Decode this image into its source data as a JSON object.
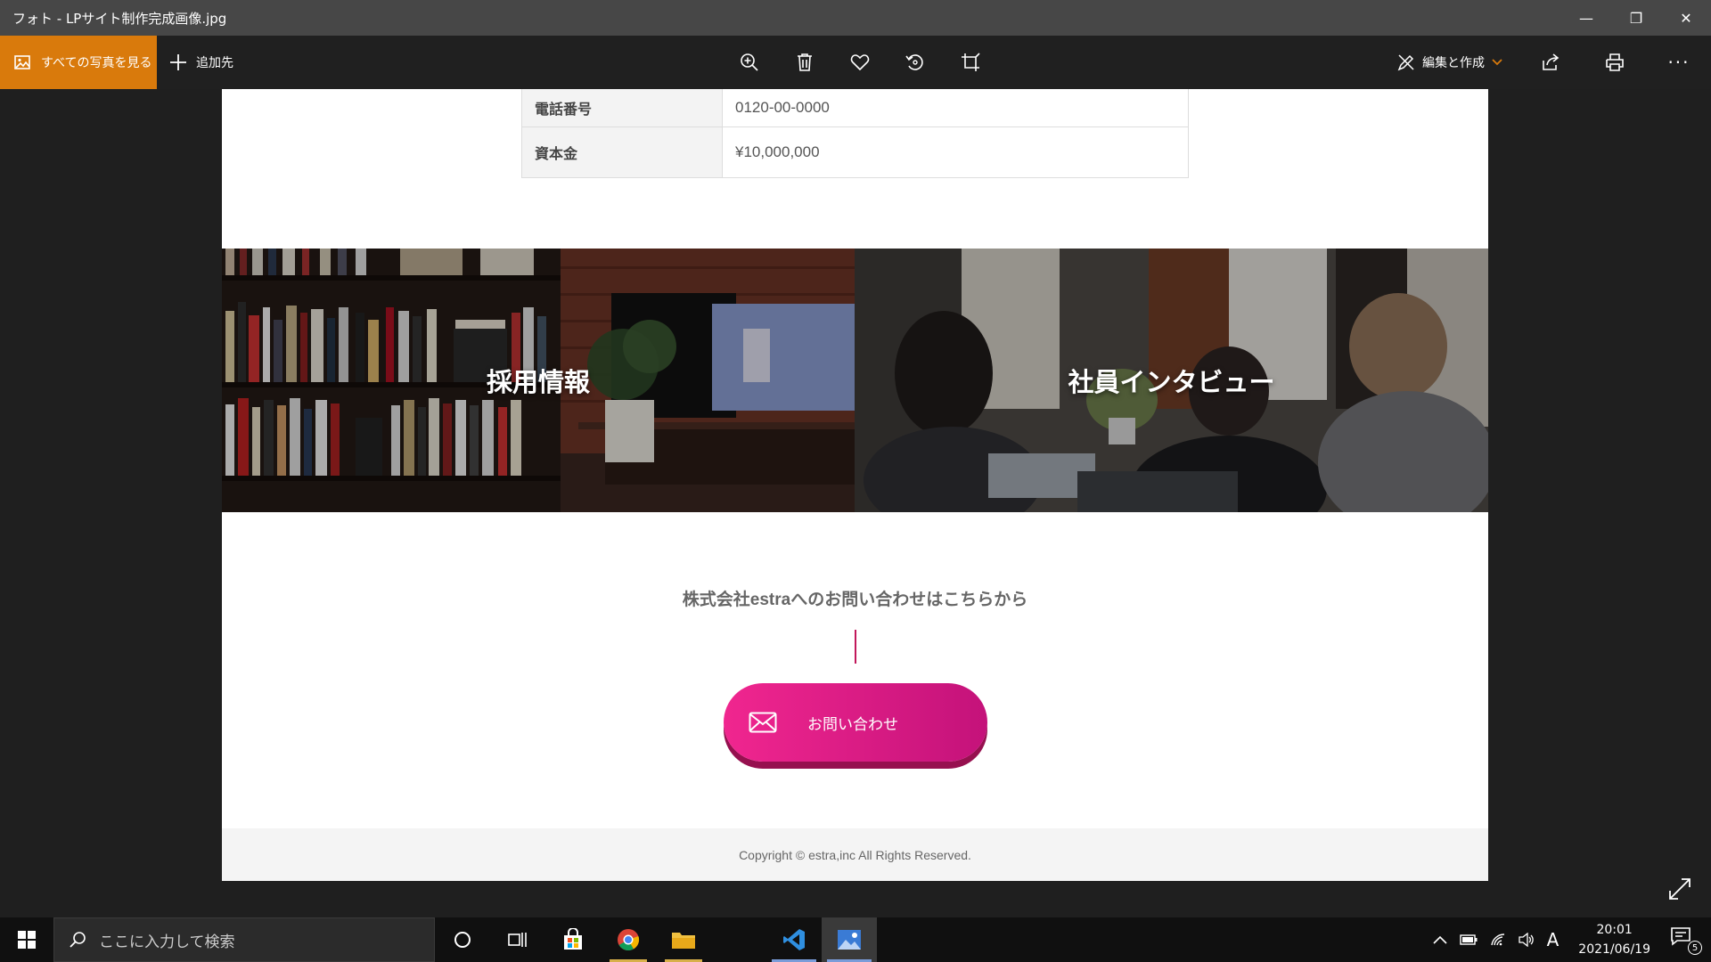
{
  "window": {
    "title": "フォト - LPサイト制作完成画像.jpg",
    "minimize": "—",
    "restore": "❐",
    "close": "✕"
  },
  "toolbar": {
    "all_photos": "すべての写真を見る",
    "add_to": "追加先",
    "edit_create": "編集と作成",
    "more": "···"
  },
  "page": {
    "info_rows": [
      {
        "label": "電話番号",
        "value": "0120-00-0000"
      },
      {
        "label": "資本金",
        "value": "¥10,000,000"
      }
    ],
    "banners": [
      {
        "label": "採用情報"
      },
      {
        "label": "社員インタビュー"
      }
    ],
    "contact_title": "株式会社estraへのお問い合わせはこちらから",
    "contact_button": "お問い合わせ",
    "footer": "Copyright © estra,inc All Rights Reserved."
  },
  "taskbar": {
    "search_placeholder": "ここに入力して検索",
    "ime": "A",
    "time": "20:01",
    "date": "2021/06/19",
    "notifications": "5"
  },
  "colors": {
    "accent_orange": "#d97a0c",
    "cta_pink": "#f0268f",
    "cta_dark": "#c4127a"
  }
}
